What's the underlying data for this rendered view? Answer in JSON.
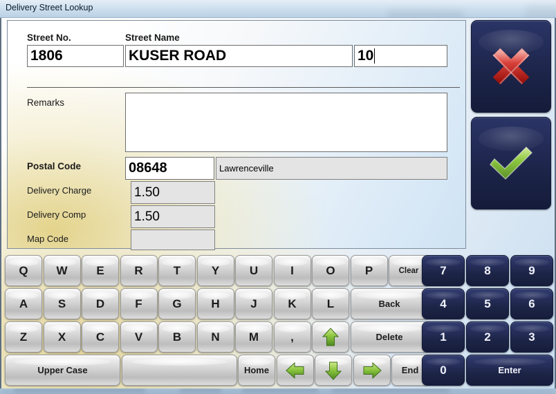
{
  "window": {
    "title": "Delivery Street Lookup"
  },
  "form": {
    "street_no_label": "Street No.",
    "street_no_value": "1806",
    "street_name_label": "Street Name",
    "street_name_value": "KUSER ROAD",
    "street_suffix_value": "10",
    "remarks_label": "Remarks",
    "remarks_value": "",
    "postal_code_label": "Postal Code",
    "postal_code_value": "08648",
    "city_value": "Lawrenceville",
    "delivery_charge_label": "Delivery Charge",
    "delivery_charge_value": "1.50",
    "delivery_comp_label": "Delivery Comp",
    "delivery_comp_value": "1.50",
    "map_code_label": "Map Code",
    "map_code_value": ""
  },
  "actions": {
    "cancel_icon": "red-x-icon",
    "confirm_icon": "green-check-icon",
    "cancel_color": "#c0221d",
    "confirm_color": "#8cc63f",
    "button_color": "#1f2851"
  },
  "keyboard": {
    "row1": [
      {
        "label": "Q",
        "name": "key-q",
        "type": "letter"
      },
      {
        "label": "W",
        "name": "key-w",
        "type": "letter"
      },
      {
        "label": "E",
        "name": "key-e",
        "type": "letter"
      },
      {
        "label": "R",
        "name": "key-r",
        "type": "letter"
      },
      {
        "label": "T",
        "name": "key-t",
        "type": "letter"
      },
      {
        "label": "Y",
        "name": "key-y",
        "type": "letter"
      },
      {
        "label": "U",
        "name": "key-u",
        "type": "letter"
      },
      {
        "label": "I",
        "name": "key-i",
        "type": "letter"
      },
      {
        "label": "O",
        "name": "key-o",
        "type": "letter"
      },
      {
        "label": "P",
        "name": "key-p",
        "type": "letter"
      },
      {
        "label": "Clear",
        "name": "key-clear",
        "type": "small"
      }
    ],
    "row2": [
      {
        "label": "A",
        "name": "key-a",
        "type": "letter"
      },
      {
        "label": "S",
        "name": "key-s",
        "type": "letter"
      },
      {
        "label": "D",
        "name": "key-d",
        "type": "letter"
      },
      {
        "label": "F",
        "name": "key-f",
        "type": "letter"
      },
      {
        "label": "G",
        "name": "key-g",
        "type": "letter"
      },
      {
        "label": "H",
        "name": "key-h",
        "type": "letter"
      },
      {
        "label": "J",
        "name": "key-j",
        "type": "letter"
      },
      {
        "label": "K",
        "name": "key-k",
        "type": "letter"
      },
      {
        "label": "L",
        "name": "key-l",
        "type": "letter"
      },
      {
        "label": "Back",
        "name": "key-back",
        "type": "word"
      }
    ],
    "row3": [
      {
        "label": "Z",
        "name": "key-z",
        "type": "letter"
      },
      {
        "label": "X",
        "name": "key-x",
        "type": "letter"
      },
      {
        "label": "C",
        "name": "key-c",
        "type": "letter"
      },
      {
        "label": "V",
        "name": "key-v",
        "type": "letter"
      },
      {
        "label": "B",
        "name": "key-b",
        "type": "letter"
      },
      {
        "label": "N",
        "name": "key-n",
        "type": "letter"
      },
      {
        "label": "M",
        "name": "key-m",
        "type": "letter"
      },
      {
        "label": ",",
        "name": "key-comma",
        "type": "letter"
      },
      {
        "label": "",
        "name": "key-arrow-up",
        "type": "icon",
        "icon": "arrow-up-icon"
      },
      {
        "label": "Delete",
        "name": "key-delete",
        "type": "word"
      }
    ],
    "row4": [
      {
        "label": "Upper Case",
        "name": "key-upper-case",
        "type": "word"
      },
      {
        "label": "",
        "name": "key-space",
        "type": "blank"
      },
      {
        "label": "Home",
        "name": "key-home",
        "type": "word"
      },
      {
        "label": "",
        "name": "key-arrow-left",
        "type": "icon",
        "icon": "arrow-left-icon"
      },
      {
        "label": "",
        "name": "key-arrow-down",
        "type": "icon",
        "icon": "arrow-down-icon"
      },
      {
        "label": "",
        "name": "key-arrow-right",
        "type": "icon",
        "icon": "arrow-right-icon"
      },
      {
        "label": "End",
        "name": "key-end",
        "type": "word"
      }
    ],
    "numpad": [
      {
        "label": "7",
        "name": "numkey-7"
      },
      {
        "label": "8",
        "name": "numkey-8"
      },
      {
        "label": "9",
        "name": "numkey-9"
      },
      {
        "label": "4",
        "name": "numkey-4"
      },
      {
        "label": "5",
        "name": "numkey-5"
      },
      {
        "label": "6",
        "name": "numkey-6"
      },
      {
        "label": "1",
        "name": "numkey-1"
      },
      {
        "label": "2",
        "name": "numkey-2"
      },
      {
        "label": "3",
        "name": "numkey-3"
      },
      {
        "label": "0",
        "name": "numkey-0"
      },
      {
        "label": "Enter",
        "name": "numkey-enter"
      }
    ]
  }
}
